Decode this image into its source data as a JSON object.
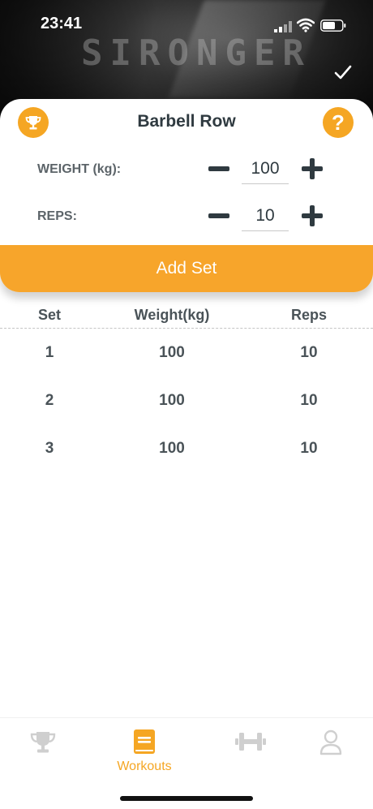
{
  "status_bar": {
    "time": "23:41"
  },
  "header": {
    "brand": "SIRONGER"
  },
  "exercise": {
    "title": "Barbell Row",
    "weight_label": "WEIGHT (kg):",
    "weight_value": "100",
    "reps_label": "REPS:",
    "reps_value": "10",
    "add_set_label": "Add Set"
  },
  "table": {
    "headers": {
      "set": "Set",
      "weight": "Weight(kg)",
      "reps": "Reps"
    },
    "rows": [
      {
        "set": "1",
        "weight": "100",
        "reps": "10"
      },
      {
        "set": "2",
        "weight": "100",
        "reps": "10"
      },
      {
        "set": "3",
        "weight": "100",
        "reps": "10"
      }
    ]
  },
  "nav": {
    "items": [
      {
        "icon": "trophy-icon",
        "label": ""
      },
      {
        "icon": "book-icon",
        "label": "Workouts",
        "active": true
      },
      {
        "icon": "dumbbell-icon",
        "label": ""
      },
      {
        "icon": "user-icon",
        "label": ""
      }
    ]
  },
  "colors": {
    "accent": "#f5a623",
    "text": "#2f3a40",
    "inactive_icon": "#cfcfcf"
  }
}
